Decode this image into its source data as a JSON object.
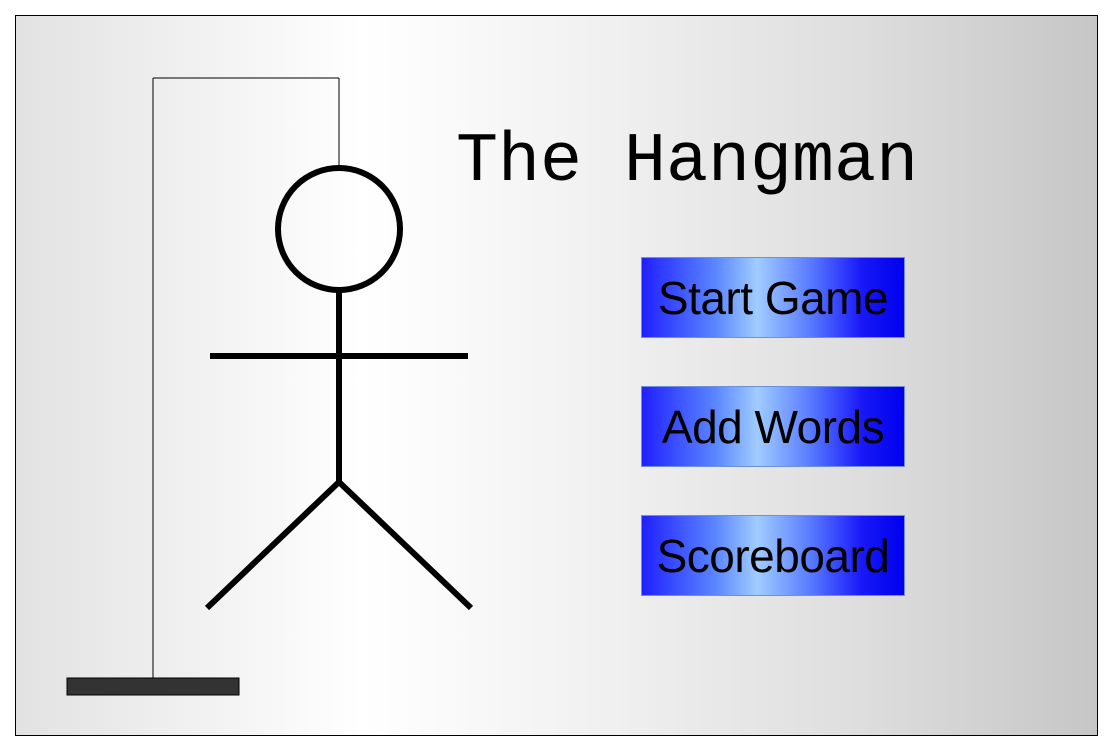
{
  "title": "The Hangman",
  "menu": {
    "start_label": "Start Game",
    "add_words_label": "Add Words",
    "scoreboard_label": "Scoreboard"
  },
  "colors": {
    "button_blue_dark": "#0000ee",
    "button_blue_light": "#a0ccff",
    "figure_stroke": "#000000",
    "base_block": "#333333"
  }
}
